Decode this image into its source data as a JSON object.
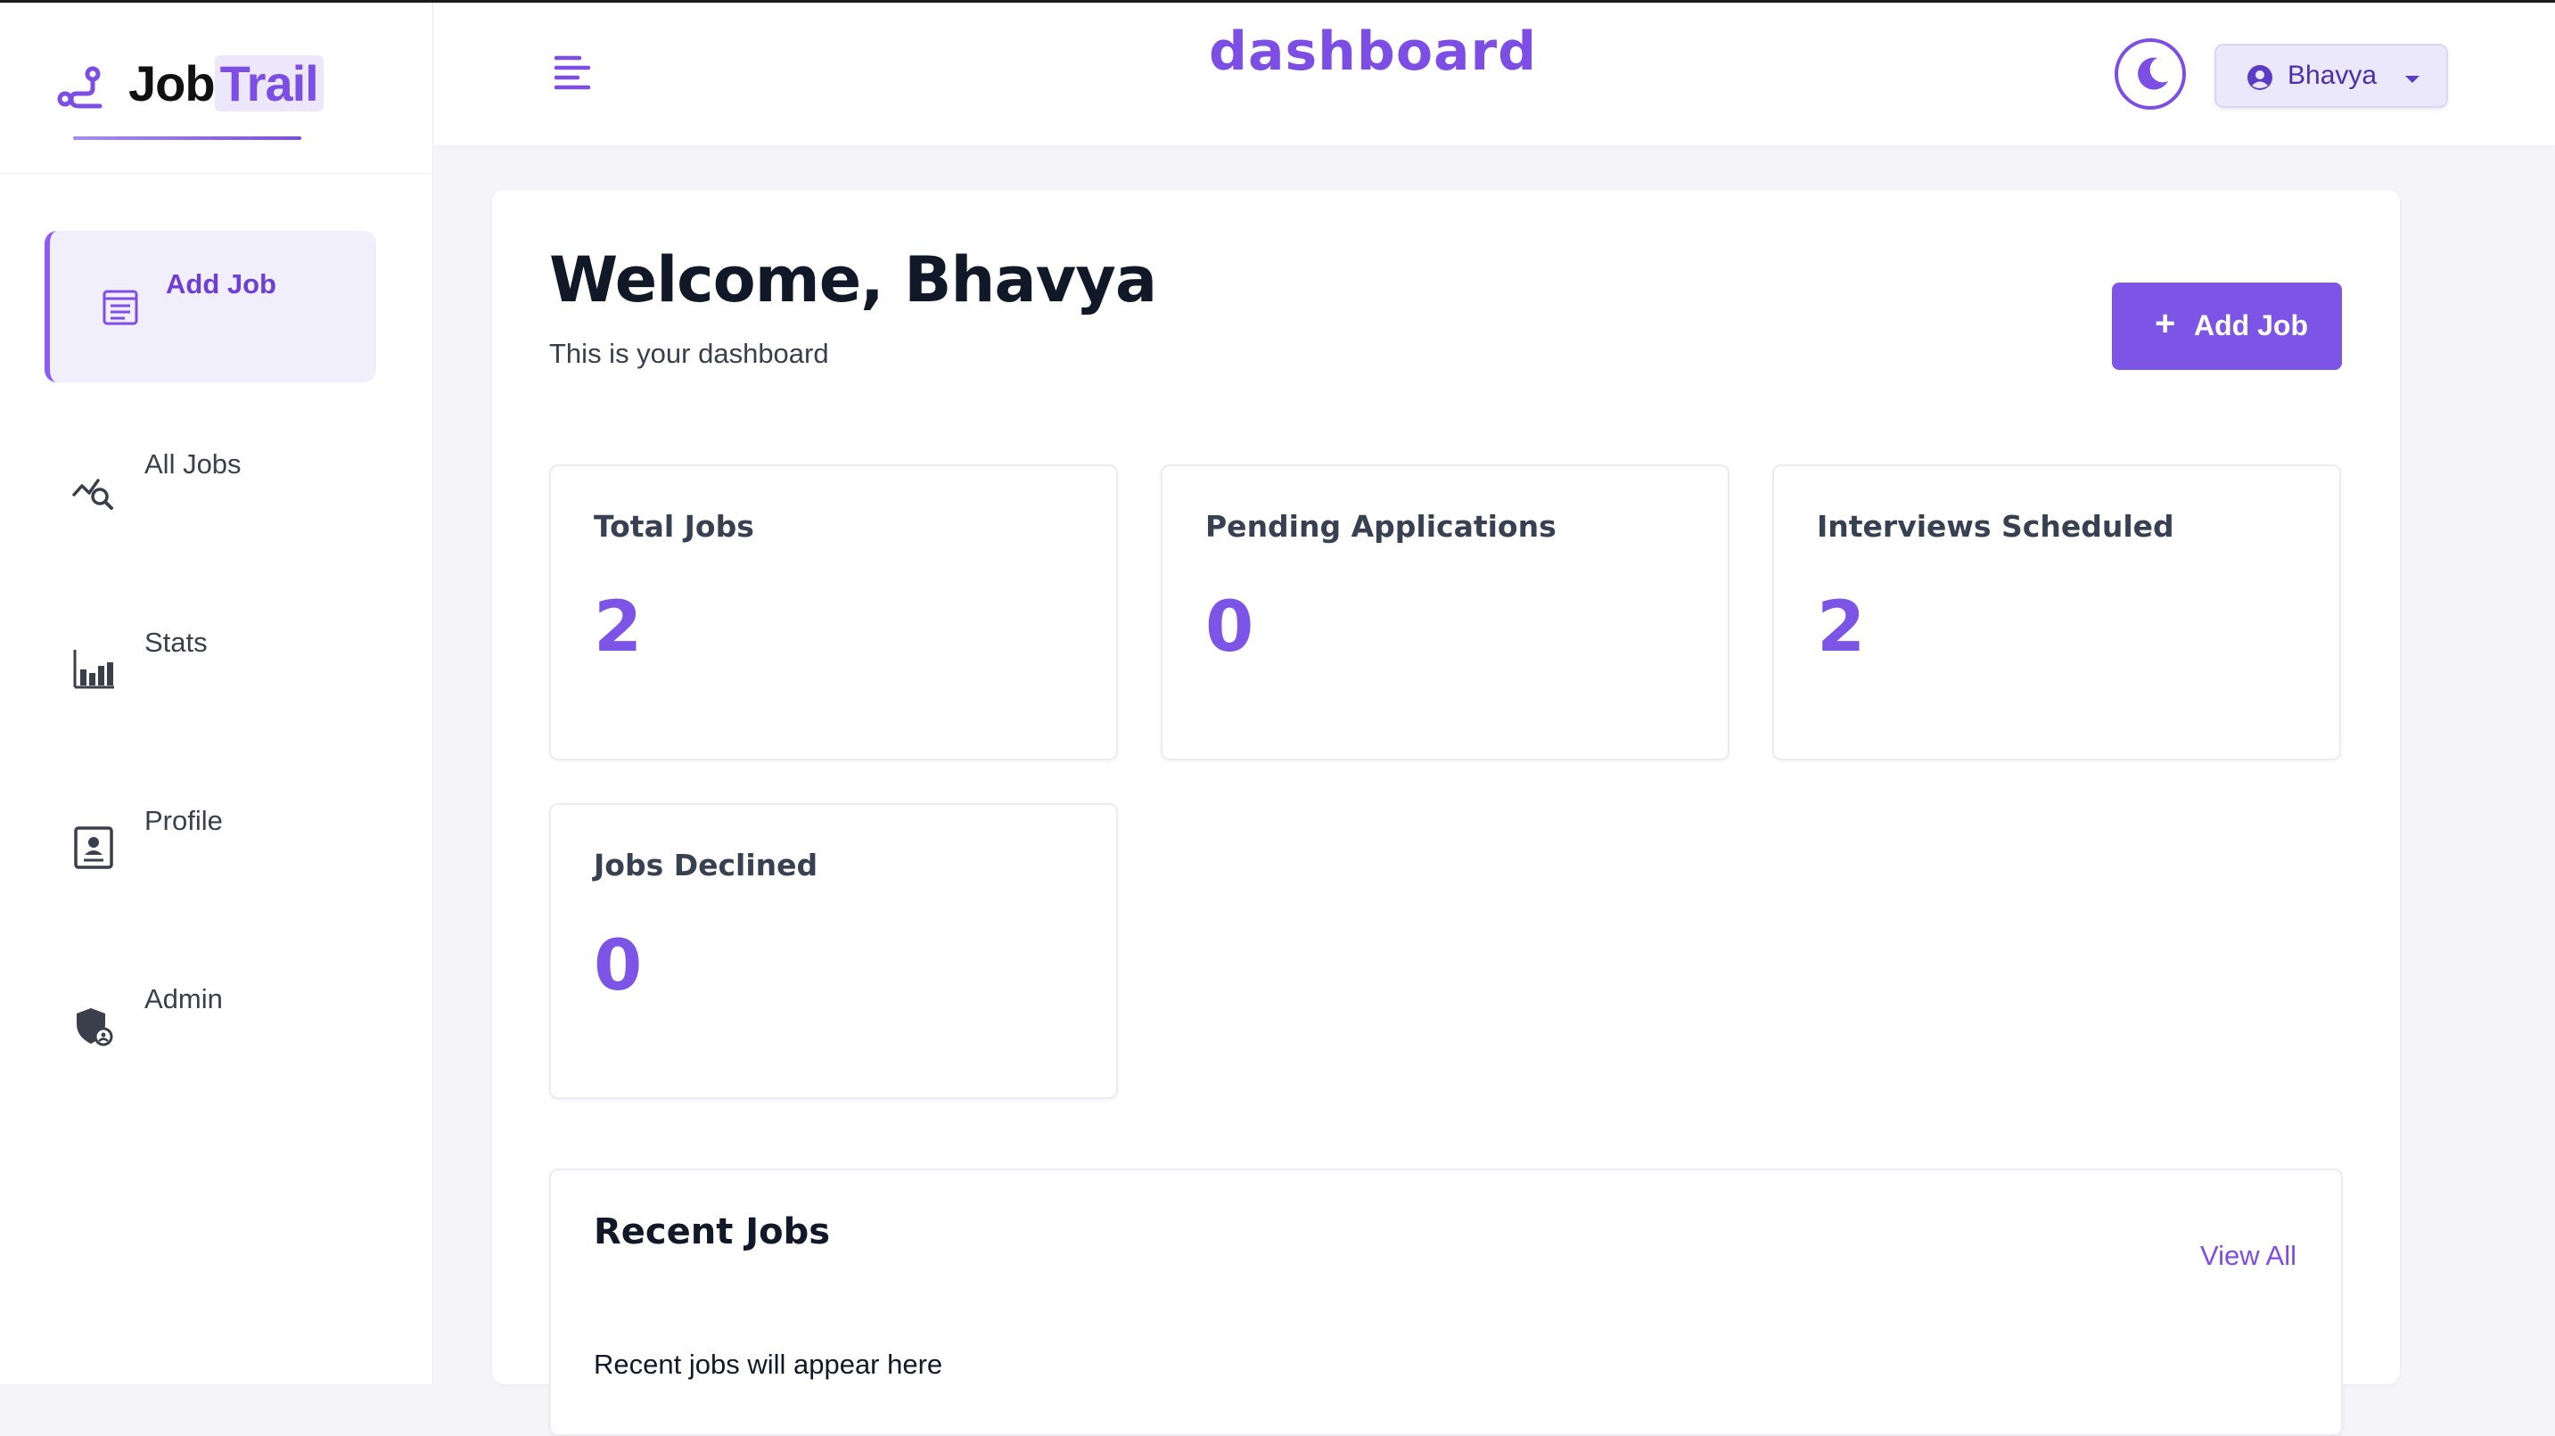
{
  "brand": {
    "name_part1": "Job",
    "name_part2": "Trail"
  },
  "header": {
    "title": "dashboard",
    "user_name": "Bhavya"
  },
  "sidebar": {
    "items": [
      {
        "label": "Add Job",
        "icon": "add-job-icon",
        "active": true
      },
      {
        "label": "All Jobs",
        "icon": "all-jobs-icon",
        "active": false
      },
      {
        "label": "Stats",
        "icon": "stats-icon",
        "active": false
      },
      {
        "label": "Profile",
        "icon": "profile-icon",
        "active": false
      },
      {
        "label": "Admin",
        "icon": "admin-icon",
        "active": false
      }
    ]
  },
  "main": {
    "welcome": "Welcome, Bhavya",
    "subtitle": "This is your dashboard",
    "add_job_button": "Add Job",
    "stats": [
      {
        "label": "Total Jobs",
        "value": "2"
      },
      {
        "label": "Pending Applications",
        "value": "0"
      },
      {
        "label": "Interviews Scheduled",
        "value": "2"
      },
      {
        "label": "Jobs Declined",
        "value": "0"
      }
    ],
    "recent": {
      "title": "Recent Jobs",
      "view_all": "View All",
      "empty_text": "Recent jobs will appear here"
    }
  },
  "colors": {
    "accent": "#7c4ee4",
    "accent_light": "#f2effd"
  }
}
